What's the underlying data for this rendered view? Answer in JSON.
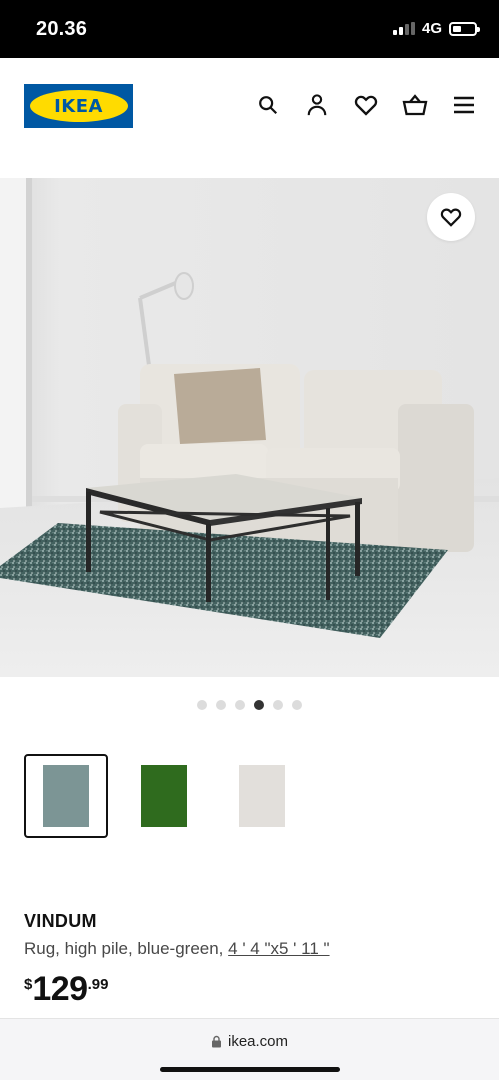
{
  "status": {
    "time": "20.36",
    "network": "4G",
    "battery_level": 0.35
  },
  "header": {
    "logo_text": "IKEA",
    "icons": [
      "search-icon",
      "user-icon",
      "heart-icon",
      "basket-icon",
      "menu-icon"
    ]
  },
  "gallery": {
    "dot_count": 6,
    "active_index": 3,
    "favorite_icon": "heart-icon"
  },
  "variants": [
    {
      "name": "blue-green",
      "color": "#7c9595",
      "selected": true
    },
    {
      "name": "green",
      "color": "#2f6b1e",
      "selected": false
    },
    {
      "name": "white",
      "color": "#e2dfdb",
      "selected": false
    }
  ],
  "product": {
    "name": "VINDUM",
    "description": "Rug, high pile, blue-green, ",
    "size": "4 ' 4 \"x5 ' 11 \"",
    "price": {
      "currency": "$",
      "integer": "129",
      "decimal": ".99"
    }
  },
  "browser": {
    "url": "ikea.com",
    "lock_icon": "lock-icon"
  },
  "colors": {
    "ikea_blue": "#0058a3",
    "ikea_yellow": "#ffdb00"
  }
}
